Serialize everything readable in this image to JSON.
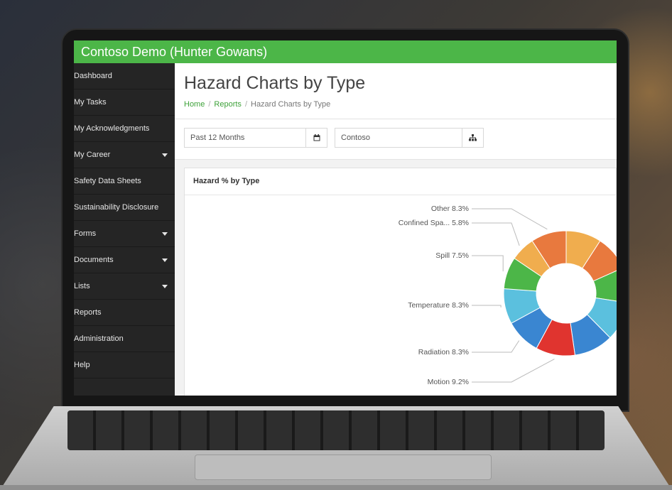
{
  "app": {
    "title": "Contoso Demo (Hunter Gowans)",
    "accent": "#4cb648"
  },
  "sidebar": {
    "items": [
      {
        "label": "Dashboard"
      },
      {
        "label": "My Tasks"
      },
      {
        "label": "My Acknowledgments"
      },
      {
        "label": "My Career",
        "caret": true
      },
      {
        "label": "Safety Data Sheets"
      },
      {
        "label": "Sustainability Disclosure"
      },
      {
        "label": "Forms",
        "caret": true
      },
      {
        "label": "Documents",
        "caret": true
      },
      {
        "label": "Lists",
        "caret": true
      },
      {
        "label": "Reports"
      },
      {
        "label": "Administration"
      },
      {
        "label": "Help"
      }
    ]
  },
  "page": {
    "title": "Hazard Charts by Type",
    "breadcrumb": {
      "home": "Home",
      "reports": "Reports",
      "current": "Hazard Charts by Type",
      "sep": "/"
    }
  },
  "filters": {
    "date_range": "Past 12 Months",
    "date_icon": "calendar-icon",
    "organization": "Contoso",
    "org_icon": "hierarchy-icon"
  },
  "card": {
    "title": "Hazard % by Type"
  },
  "chart_data": {
    "type": "pie",
    "donut": true,
    "title": "Hazard % by Type",
    "labeled_slices": [
      {
        "label": "Other 8.3%",
        "name": "Other",
        "value": 8.3,
        "color": "#e8793e"
      },
      {
        "label": "Confined Spa... 5.8%",
        "name": "Confined Spa...",
        "value": 5.8,
        "color": "#f0ad4e"
      },
      {
        "label": "Spill 7.5%",
        "name": "Spill",
        "value": 7.5,
        "color": "#4cb648"
      },
      {
        "label": "Temperature 8.3%",
        "name": "Temperature",
        "value": 8.3,
        "color": "#5bc0de"
      },
      {
        "label": "Radiation 8.3%",
        "name": "Radiation",
        "value": 8.3,
        "color": "#3a86d1"
      },
      {
        "label": "Motion 9.2%",
        "name": "Motion",
        "value": 9.2,
        "color": "#e0342f"
      }
    ],
    "unlabeled_slices": [
      {
        "value": 8.3,
        "color": "#f0ad4e"
      },
      {
        "value": 8.3,
        "color": "#e8793e"
      },
      {
        "value": 8.3,
        "color": "#4cb648"
      },
      {
        "value": 9.2,
        "color": "#5bc0de"
      },
      {
        "value": 9.2,
        "color": "#3a86d1"
      }
    ]
  }
}
